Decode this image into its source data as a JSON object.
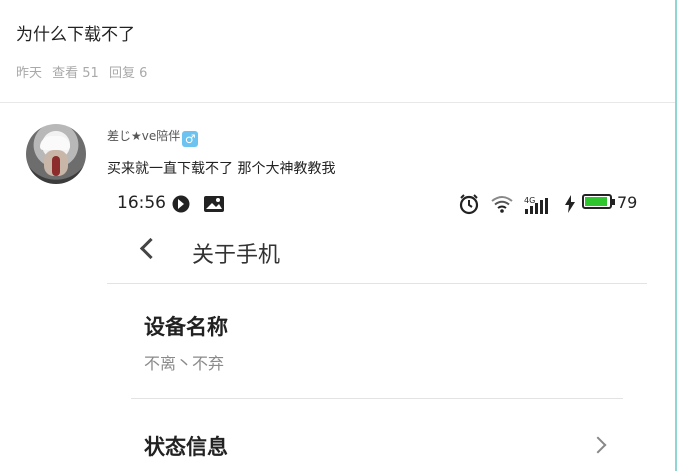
{
  "post": {
    "title": "为什么下载不了",
    "meta": {
      "time": "昨天",
      "views": "查看 51",
      "replies": "回复 6"
    }
  },
  "reply": {
    "username": "差じ★ve陪伴",
    "gender_symbol": "♂",
    "text": "买来就一直下载不了  那个大神教教我"
  },
  "screenshot": {
    "status_bar": {
      "time": "16:56",
      "network": "4G",
      "battery_level": "79"
    },
    "nav": {
      "title": "关于手机"
    },
    "items": [
      {
        "title": "设备名称",
        "value": "不离丶不弃"
      },
      {
        "title": "状态信息"
      }
    ]
  },
  "colors": {
    "battery": "#2fc52f",
    "gender_badge": "#6cc3f0",
    "edge_accent": "#8fd6d2"
  }
}
